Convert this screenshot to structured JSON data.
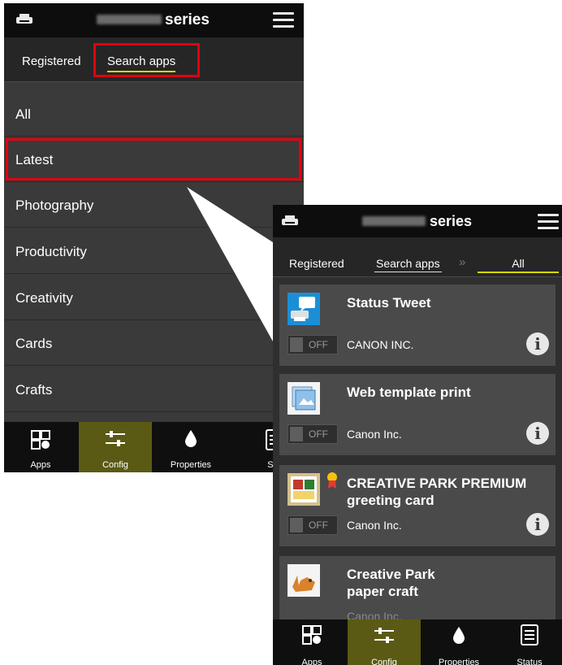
{
  "screen1": {
    "header": {
      "series": "series"
    },
    "tabs": {
      "registered": "Registered",
      "search_apps": "Search apps"
    },
    "categories": [
      "All",
      "Latest",
      "Photography",
      "Productivity",
      "Creativity",
      "Cards",
      "Crafts",
      "F"
    ],
    "nav": {
      "apps": "Apps",
      "config": "Config",
      "properties": "Properties",
      "status": "Sta"
    }
  },
  "screen2": {
    "header": {
      "series": "series"
    },
    "tabs": {
      "registered": "Registered",
      "search_apps": "Search apps",
      "separator": "»",
      "all": "All"
    },
    "apps": [
      {
        "title": "Status Tweet",
        "vendor": "CANON INC.",
        "toggle": "OFF"
      },
      {
        "title": "Web template print",
        "vendor": "Canon Inc.",
        "toggle": "OFF"
      },
      {
        "title_line1": "CREATIVE PARK PREMIUM",
        "title_line2": "greeting card",
        "vendor": "Canon Inc.",
        "toggle": "OFF"
      },
      {
        "title_line1": "Creative Park",
        "title_line2": "paper craft",
        "vendor": "Canon Inc."
      }
    ],
    "nav": {
      "apps": "Apps",
      "config": "Config",
      "properties": "Properties",
      "status": "Status"
    }
  },
  "colors": {
    "highlight": "#e00010",
    "underline": "#d6d600",
    "active_nav": "#5a5a14"
  }
}
